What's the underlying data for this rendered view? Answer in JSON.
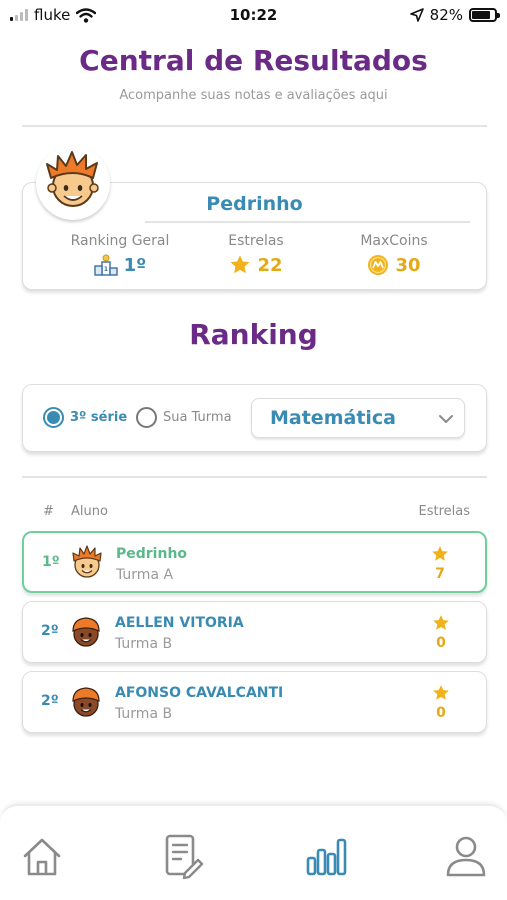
{
  "status_bar": {
    "carrier": "fluke",
    "time": "10:22",
    "battery": "82%",
    "battery_level": 0.82,
    "signal_bars_active": 1
  },
  "header": {
    "title": "Central de Resultados",
    "subtitle": "Acompanhe suas notas e avaliações aqui"
  },
  "profile": {
    "name": "Pedrinho",
    "stats": [
      {
        "label": "Ranking Geral",
        "value": "1º",
        "icon": "podium-icon"
      },
      {
        "label": "Estrelas",
        "value": "22",
        "icon": "star-icon"
      },
      {
        "label": "MaxCoins",
        "value": "30",
        "icon": "coin-icon"
      }
    ]
  },
  "ranking": {
    "title": "Ranking",
    "filters": {
      "option_grade": "3º série",
      "option_class": "Sua Turma",
      "selected": "3º série",
      "subject": "Matemática"
    },
    "columns": {
      "position": "#",
      "student": "Aluno",
      "stars": "Estrelas"
    },
    "rows": [
      {
        "position": "1º",
        "name": "Pedrinho",
        "class": "Turma A",
        "stars": "7",
        "highlight": true,
        "avatar": "boy-avatar-light"
      },
      {
        "position": "2º",
        "name": "AELLEN VITORIA",
        "class": "Turma B",
        "stars": "0",
        "highlight": false,
        "avatar": "boy-avatar-dark"
      },
      {
        "position": "2º",
        "name": "AFONSO CAVALCANTI",
        "class": "Turma B",
        "stars": "0",
        "highlight": false,
        "avatar": "boy-avatar-dark"
      }
    ]
  },
  "colors": {
    "purple": "#6a2a86",
    "blue": "#3a8bb3",
    "green": "#5cb88a",
    "gold": "#e5a918",
    "highlight_border": "#6fcf9d"
  },
  "bottom_nav": [
    {
      "icon": "home-icon",
      "active": false
    },
    {
      "icon": "edit-document-icon",
      "active": false
    },
    {
      "icon": "bar-chart-icon",
      "active": true
    },
    {
      "icon": "user-icon",
      "active": false
    }
  ]
}
